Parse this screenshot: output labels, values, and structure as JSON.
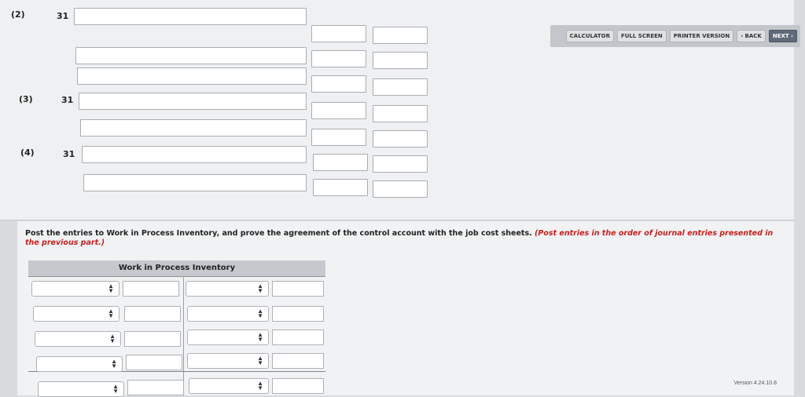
{
  "toolbar": {
    "calculator": "CALCULATOR",
    "full_screen": "FULL SCREEN",
    "printer_version": "PRINTER VERSION",
    "back": "‹ BACK",
    "next": "NEXT ›"
  },
  "entries": [
    {
      "label": "(2)",
      "date": "31"
    },
    {
      "label": "(3)",
      "date": "31"
    },
    {
      "label": "(4)",
      "date": "31"
    }
  ],
  "instruction": {
    "main": "Post the entries to Work in Process Inventory, and prove the agreement of the control account with the job cost sheets. ",
    "red": "(Post entries in the order of journal entries presented in the previous part.)"
  },
  "ledger": {
    "title": "Work in Process Inventory"
  },
  "version": "Version 4.24.10.8"
}
